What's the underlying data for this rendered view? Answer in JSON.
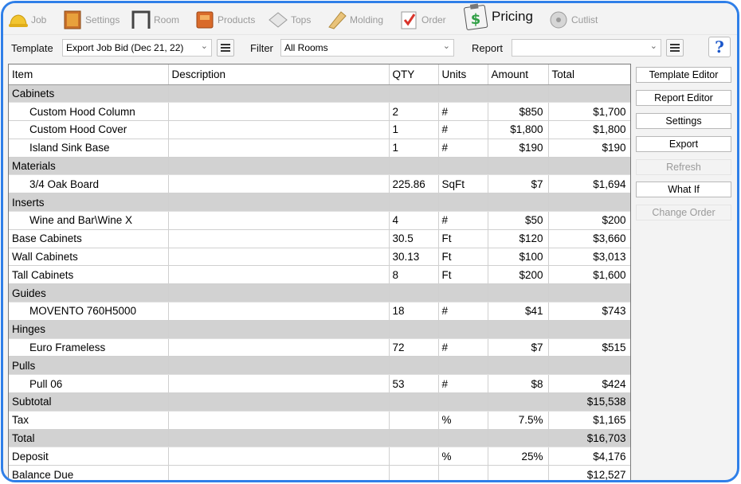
{
  "tabs": [
    {
      "id": "job",
      "label": "Job",
      "icon": "hardhat-icon"
    },
    {
      "id": "settings",
      "label": "Settings",
      "icon": "cabinet-icon"
    },
    {
      "id": "room",
      "label": "Room",
      "icon": "room-icon"
    },
    {
      "id": "products",
      "label": "Products",
      "icon": "products-icon"
    },
    {
      "id": "tops",
      "label": "Tops",
      "icon": "countertop-icon"
    },
    {
      "id": "molding",
      "label": "Molding",
      "icon": "molding-icon"
    },
    {
      "id": "order",
      "label": "Order",
      "icon": "checklist-icon"
    },
    {
      "id": "pricing",
      "label": "Pricing",
      "icon": "pricing-clipboard-icon",
      "active": true
    },
    {
      "id": "cutlist",
      "label": "Cutlist",
      "icon": "sawblade-icon"
    }
  ],
  "toolbar": {
    "template_label": "Template",
    "template_value": "Export Job Bid (Dec 21, 22)",
    "filter_label": "Filter",
    "filter_value": "All Rooms",
    "report_label": "Report",
    "report_value": "",
    "help_glyph": "?"
  },
  "grid": {
    "columns": [
      "Item",
      "Description",
      "QTY",
      "Units",
      "Amount",
      "Total"
    ],
    "rows": [
      {
        "type": "group",
        "item": "Cabinets",
        "description": "",
        "qty": "",
        "units": "",
        "amount": "",
        "total": ""
      },
      {
        "type": "item",
        "item": "Custom Hood Column",
        "description": "",
        "qty": "2",
        "units": "#",
        "amount": "$850",
        "total": "$1,700"
      },
      {
        "type": "item",
        "item": "Custom Hood Cover",
        "description": "",
        "qty": "1",
        "units": "#",
        "amount": "$1,800",
        "total": "$1,800"
      },
      {
        "type": "item",
        "item": "Island Sink Base",
        "description": "",
        "qty": "1",
        "units": "#",
        "amount": "$190",
        "total": "$190"
      },
      {
        "type": "group",
        "item": "Materials",
        "description": "",
        "qty": "",
        "units": "",
        "amount": "",
        "total": ""
      },
      {
        "type": "item",
        "item": "3/4 Oak Board",
        "description": "",
        "qty": "225.86",
        "units": "SqFt",
        "amount": "$7",
        "total": "$1,694"
      },
      {
        "type": "group",
        "item": "Inserts",
        "description": "",
        "qty": "",
        "units": "",
        "amount": "",
        "total": ""
      },
      {
        "type": "item",
        "item": "Wine and Bar\\Wine X",
        "description": "",
        "qty": "4",
        "units": "#",
        "amount": "$50",
        "total": "$200"
      },
      {
        "type": "plain",
        "item": "Base Cabinets",
        "description": "",
        "qty": "30.5",
        "units": "Ft",
        "amount": "$120",
        "total": "$3,660"
      },
      {
        "type": "plain",
        "item": "Wall Cabinets",
        "description": "",
        "qty": "30.13",
        "units": "Ft",
        "amount": "$100",
        "total": "$3,013"
      },
      {
        "type": "plain",
        "item": "Tall Cabinets",
        "description": "",
        "qty": "8",
        "units": "Ft",
        "amount": "$200",
        "total": "$1,600"
      },
      {
        "type": "group",
        "item": "Guides",
        "description": "",
        "qty": "",
        "units": "",
        "amount": "",
        "total": ""
      },
      {
        "type": "item",
        "item": "MOVENTO 760H5000",
        "description": "",
        "qty": "18",
        "units": "#",
        "amount": "$41",
        "total": "$743"
      },
      {
        "type": "group",
        "item": "Hinges",
        "description": "",
        "qty": "",
        "units": "",
        "amount": "",
        "total": ""
      },
      {
        "type": "item",
        "item": "Euro Frameless",
        "description": "",
        "qty": "72",
        "units": "#",
        "amount": "$7",
        "total": "$515"
      },
      {
        "type": "group",
        "item": "Pulls",
        "description": "",
        "qty": "",
        "units": "",
        "amount": "",
        "total": ""
      },
      {
        "type": "item",
        "item": "Pull 06",
        "description": "",
        "qty": "53",
        "units": "#",
        "amount": "$8",
        "total": "$424"
      },
      {
        "type": "group",
        "item": "Subtotal",
        "description": "",
        "qty": "",
        "units": "",
        "amount": "",
        "total": "$15,538"
      },
      {
        "type": "plain",
        "item": "Tax",
        "description": "",
        "qty": "",
        "units": "%",
        "amount": "7.5%",
        "total": "$1,165"
      },
      {
        "type": "group",
        "item": "Total",
        "description": "",
        "qty": "",
        "units": "",
        "amount": "",
        "total": "$16,703"
      },
      {
        "type": "plain",
        "item": "Deposit",
        "description": "",
        "qty": "",
        "units": "%",
        "amount": "25%",
        "total": "$4,176"
      },
      {
        "type": "plain",
        "item": "Balance Due",
        "description": "",
        "qty": "",
        "units": "",
        "amount": "",
        "total": "$12,527"
      }
    ]
  },
  "side_buttons": [
    {
      "name": "template-editor-button",
      "label": "Template Editor",
      "enabled": true
    },
    {
      "name": "report-editor-button",
      "label": "Report Editor",
      "enabled": true
    },
    {
      "name": "settings-button",
      "label": "Settings",
      "enabled": true
    },
    {
      "name": "export-button",
      "label": "Export",
      "enabled": true
    },
    {
      "name": "refresh-button",
      "label": "Refresh",
      "enabled": false
    },
    {
      "name": "what-if-button",
      "label": "What If",
      "enabled": true
    },
    {
      "name": "change-order-button",
      "label": "Change Order",
      "enabled": false
    }
  ],
  "colors": {
    "window_border": "#2f7fe8",
    "group_row": "#d2d2d2",
    "pricing_icon_green": "#2f9e44",
    "help_blue": "#1a56c9"
  }
}
